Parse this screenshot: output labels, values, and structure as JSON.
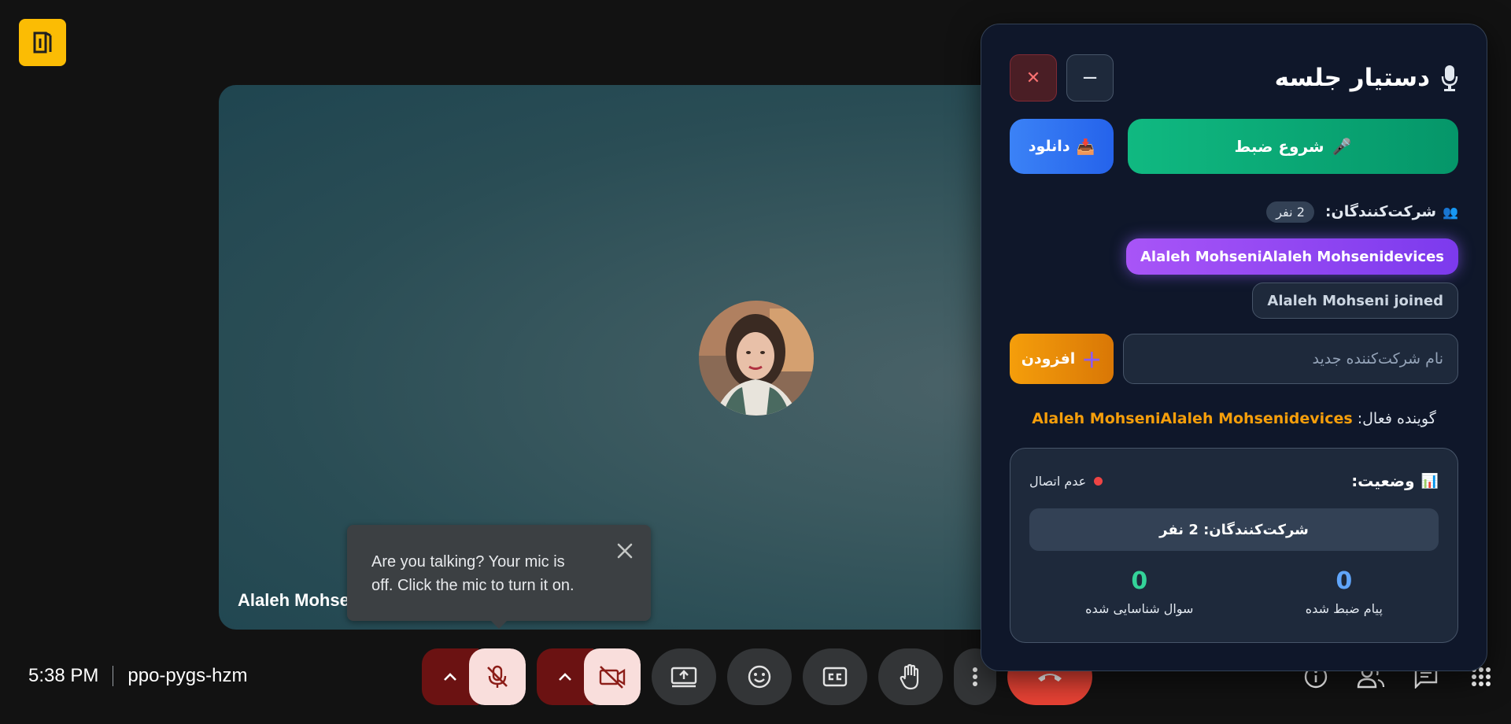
{
  "meeting": {
    "time": "5:38 PM",
    "code": "ppo-pygs-hzm"
  },
  "tile": {
    "participant_name": "Alaleh Mohseni"
  },
  "tooltip": {
    "text": "Are you talking? Your mic is off. Click the mic to turn it on."
  },
  "assistant": {
    "title": "دستیار جلسه",
    "record_label": "شروع ضبط",
    "download_label": "دانلود",
    "participants_label": "شرکت‌کنندگان:",
    "participants_count": "2 نفر",
    "chips": {
      "speaker": "Alaleh MohseniAlaleh Mohsenidevices",
      "joined": "Alaleh Mohseni joined"
    },
    "new_participant_placeholder": "نام شرکت‌کننده جدید",
    "add_label": "افزودن",
    "active_speaker_label": "گوینده فعال:",
    "active_speaker_name": "Alaleh MohseniAlaleh Mohsenidevices",
    "status": {
      "label": "وضعیت:",
      "connection": "عدم اتصال",
      "participants_summary": "شرکت‌کنندگان: 2 نفر",
      "stats": [
        {
          "value": "0",
          "label": "پیام ضبط شده",
          "color": "#60a5fa"
        },
        {
          "value": "0",
          "label": "سوال شناسایی شده",
          "color": "#34d399"
        }
      ]
    }
  },
  "colors": {
    "accent_record": "#10b981",
    "accent_download": "#3b82f6",
    "accent_add": "#f59e0b",
    "end_call": "#ea4335",
    "mic_off_bg": "#f9dedc"
  }
}
